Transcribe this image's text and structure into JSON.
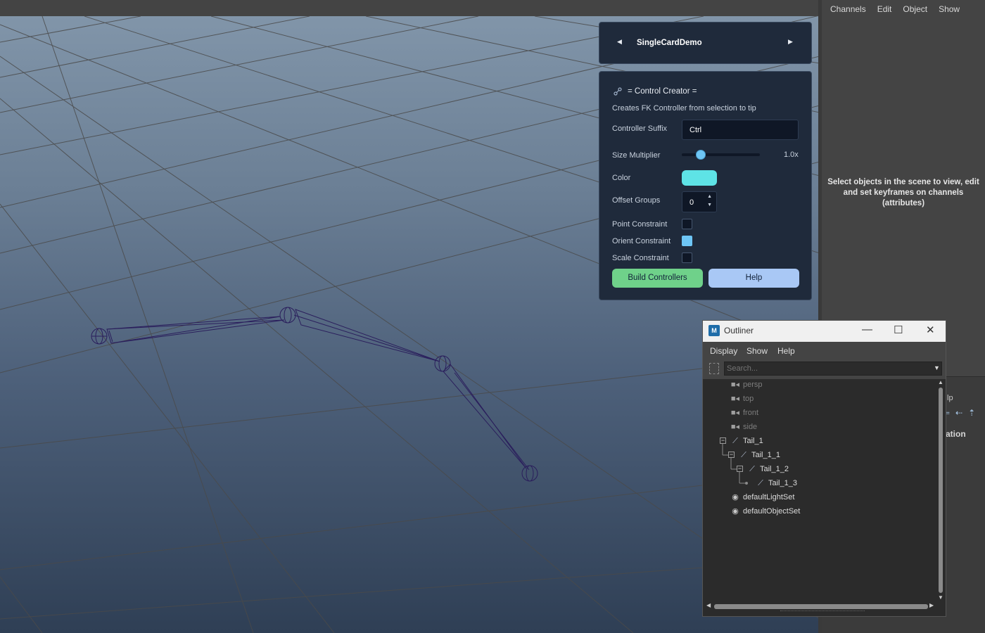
{
  "channel_box": {
    "menu": [
      "Channels",
      "Edit",
      "Object",
      "Show"
    ],
    "empty_message": "Select objects in the scene to view, edit and set keyframes on channels (attributes)",
    "partial_text_1": "lp",
    "partial_text_2": "ation"
  },
  "card_switcher": {
    "title": "SingleCardDemo",
    "prev_icon": "triangle-left",
    "next_icon": "triangle-right"
  },
  "control_creator": {
    "title": "= Control Creator =",
    "description": "Creates FK Controller from selection to tip",
    "suffix_label": "Controller Suffix",
    "suffix_value": "Ctrl",
    "size_label": "Size Multiplier",
    "size_value": "1.0x",
    "size_fraction": 0.24,
    "color_label": "Color",
    "color_value": "#5ee3e6",
    "offset_label": "Offset Groups",
    "offset_value": "0",
    "point_label": "Point Constraint",
    "point_checked": false,
    "orient_label": "Orient Constraint",
    "orient_checked": true,
    "scale_label": "Scale Constraint",
    "scale_checked": false,
    "build_label": "Build Controllers",
    "help_label": "Help",
    "build_color": "#6fd18a",
    "help_color": "#a9c8f5"
  },
  "outliner": {
    "title": "Outliner",
    "menu": [
      "Display",
      "Show",
      "Help"
    ],
    "search_placeholder": "Search...",
    "cameras": [
      "persp",
      "top",
      "front",
      "side"
    ],
    "joints": [
      "Tail_1",
      "Tail_1_1",
      "Tail_1_2",
      "Tail_1_3"
    ],
    "sets": [
      "defaultLightSet",
      "defaultObjectSet"
    ]
  },
  "colors": {
    "accent": "#6ec6f5",
    "card_bg": "#1f2a3b",
    "joint_wire": "#2a1e5c"
  }
}
